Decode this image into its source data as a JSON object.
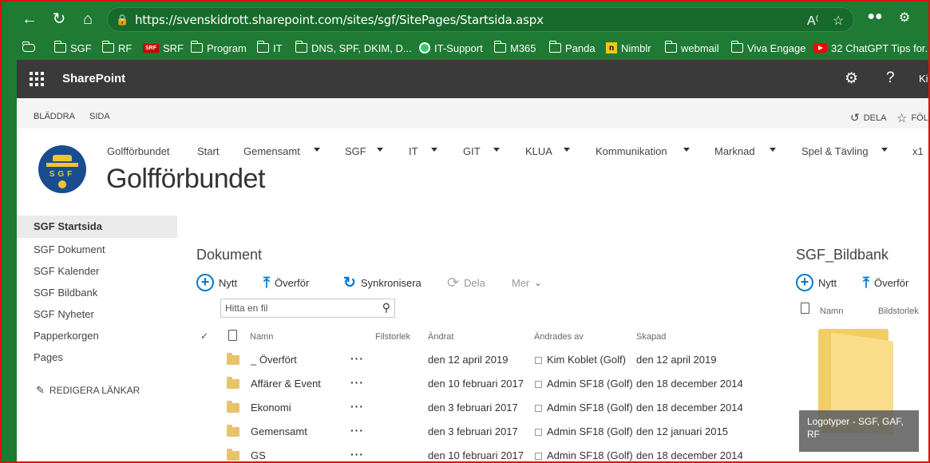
{
  "browser": {
    "url": "https://svenskidrott.sharepoint.com/sites/sgf/SitePages/Startsida.aspx",
    "accent": "#1f7a34",
    "bookmarks": [
      {
        "label": "SGF",
        "icon": "folder-icon"
      },
      {
        "label": "RF",
        "icon": "folder-icon"
      },
      {
        "label": "SRF",
        "icon": "srf-icon"
      },
      {
        "label": "Program",
        "icon": "folder-icon"
      },
      {
        "label": "IT",
        "icon": "folder-icon"
      },
      {
        "label": "DNS, SPF, DKIM, D...",
        "icon": "folder-icon"
      },
      {
        "label": "IT-Support",
        "icon": "green-circle-icon"
      },
      {
        "label": "M365",
        "icon": "folder-icon"
      },
      {
        "label": "Panda",
        "icon": "folder-icon"
      },
      {
        "label": "Nimblr",
        "icon": "nimblr-icon"
      },
      {
        "label": "webmail",
        "icon": "folder-icon"
      },
      {
        "label": "Viva Engage",
        "icon": "folder-icon"
      },
      {
        "label": "32 ChatGPT Tips for...",
        "icon": "youtube-icon"
      }
    ]
  },
  "suitebar": {
    "app_name": "SharePoint",
    "user_initials": "Ki"
  },
  "ribbon": {
    "tabs": [
      "BLÄDDRA",
      "SIDA"
    ],
    "share_label": "DELA",
    "follow_label": "FÖL"
  },
  "site": {
    "title": "Golfförbundet",
    "logo_letters": "SGF",
    "topnav": [
      {
        "label": "Golfförbundet",
        "dropdown": false
      },
      {
        "label": "Start",
        "dropdown": false
      },
      {
        "label": "Gemensamt",
        "dropdown": true
      },
      {
        "label": "SGF",
        "dropdown": true
      },
      {
        "label": "IT",
        "dropdown": true
      },
      {
        "label": "GIT",
        "dropdown": true
      },
      {
        "label": "KLUA",
        "dropdown": true
      },
      {
        "label": "Kommunikation",
        "dropdown": true
      },
      {
        "label": "Marknad",
        "dropdown": true
      },
      {
        "label": "Spel & Tävling",
        "dropdown": true
      },
      {
        "label": "x1",
        "dropdown": false
      }
    ]
  },
  "leftnav": {
    "items": [
      "SGF Startsida",
      "SGF Dokument",
      "SGF Kalender",
      "SGF Bildbank",
      "SGF Nyheter",
      "Papperkorgen",
      "Pages"
    ],
    "selected": "SGF Startsida",
    "edit_label": "REDIGERA LÄNKAR"
  },
  "documents": {
    "title": "Dokument",
    "commands": {
      "new": "Nytt",
      "upload": "Överför",
      "sync": "Synkronisera",
      "share": "Dela",
      "more": "Mer"
    },
    "search_placeholder": "Hitta en fil",
    "columns": {
      "name": "Namn",
      "size": "Filstorlek",
      "changed": "Ändrat",
      "changed_by": "Ändrades av",
      "created": "Skapad"
    },
    "rows": [
      {
        "name": "_ Överfört",
        "changed": "den 12 april 2019",
        "changed_by": "Kim Koblet (Golf)",
        "created": "den 12 april 2019"
      },
      {
        "name": "Affärer & Event",
        "changed": "den 10 februari 2017",
        "changed_by": "Admin SF18 (Golf)",
        "created": "den 18 december 2014"
      },
      {
        "name": "Ekonomi",
        "changed": "den 3 februari 2017",
        "changed_by": "Admin SF18 (Golf)",
        "created": "den 18 december 2014"
      },
      {
        "name": "Gemensamt",
        "changed": "den 3 februari 2017",
        "changed_by": "Admin SF18 (Golf)",
        "created": "den 12 januari 2015"
      },
      {
        "name": "GS",
        "changed": "den 10 februari 2017",
        "changed_by": "Admin SF18 (Golf)",
        "created": "den 18 december 2014"
      }
    ]
  },
  "bildbank": {
    "title": "SGF_Bildbank",
    "commands": {
      "new": "Nytt",
      "upload": "Överför"
    },
    "columns": {
      "name": "Namn",
      "size": "Bildstorlek"
    },
    "tile_caption": "Logotyper - SGF, GAF, RF"
  }
}
